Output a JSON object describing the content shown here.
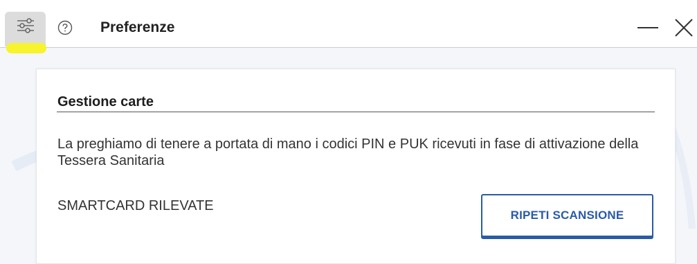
{
  "window": {
    "title": "Preferenze",
    "icons": {
      "settings": "sliders-icon",
      "help": "help-circle-icon",
      "minimize": "minimize-icon",
      "close": "close-icon"
    }
  },
  "card": {
    "section_title": "Gestione carte",
    "description": "La preghiamo di tenere a portata di mano i codici PIN e PUK ricevuti in fase di attivazione della Tessera Sanitaria",
    "detected_label": "SMARTCARD RILEVATE",
    "rescan_button": "RIPETI SCANSIONE"
  },
  "colors": {
    "accent": "#2a5aa6",
    "highlight": "#f7f32c",
    "settings_bg": "#dcdcdc"
  }
}
